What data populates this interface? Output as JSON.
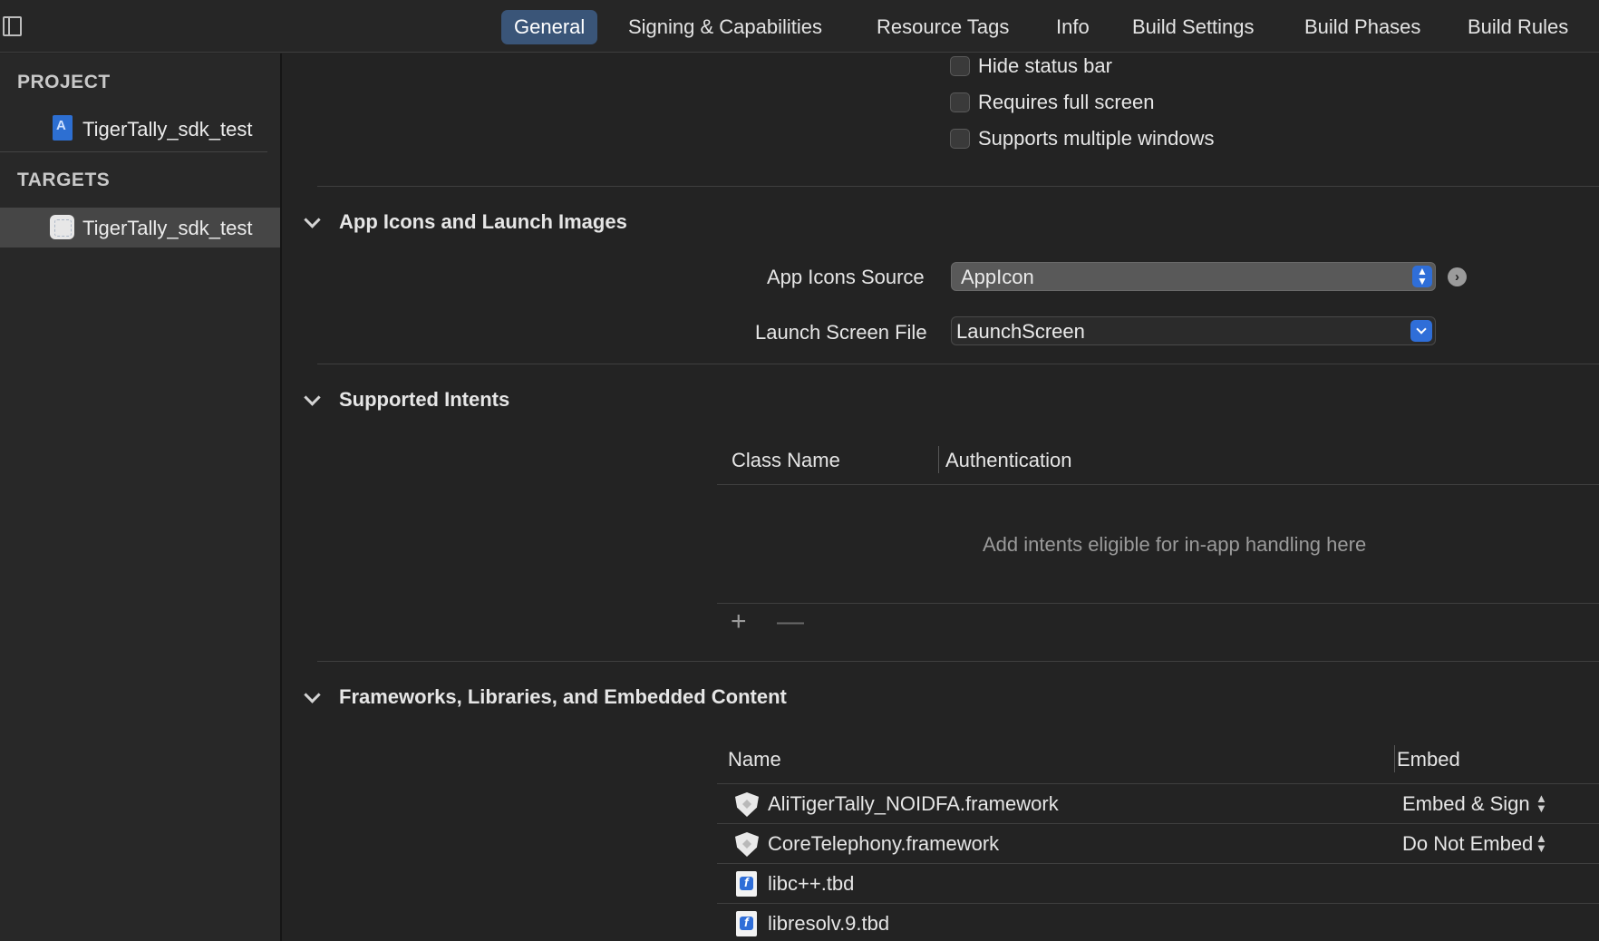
{
  "tabs": [
    {
      "label": "General",
      "active": true
    },
    {
      "label": "Signing & Capabilities"
    },
    {
      "label": "Resource Tags"
    },
    {
      "label": "Info"
    },
    {
      "label": "Build Settings"
    },
    {
      "label": "Build Phases"
    },
    {
      "label": "Build Rules"
    }
  ],
  "sidebar": {
    "project_header": "PROJECT",
    "project_item": "TigerTally_sdk_test",
    "targets_header": "TARGETS",
    "target_item": "TigerTally_sdk_test"
  },
  "deployment": {
    "checkboxes": [
      {
        "label": "Hide status bar",
        "checked": false
      },
      {
        "label": "Requires full screen",
        "checked": false
      },
      {
        "label": "Supports multiple windows",
        "checked": false
      }
    ]
  },
  "app_icons": {
    "title": "App Icons and Launch Images",
    "icons_source_label": "App Icons Source",
    "icons_source_value": "AppIcon",
    "launch_screen_label": "Launch Screen File",
    "launch_screen_value": "LaunchScreen"
  },
  "intents": {
    "title": "Supported Intents",
    "col_class_name": "Class Name",
    "col_authentication": "Authentication",
    "empty_message": "Add intents eligible for in-app handling here",
    "add_label": "+",
    "remove_label": "—"
  },
  "frameworks": {
    "title": "Frameworks, Libraries, and Embedded Content",
    "col_name": "Name",
    "col_embed": "Embed",
    "items": [
      {
        "name": "AliTigerTally_NOIDFA.framework",
        "embed": "Embed & Sign",
        "icon": "shield-icon"
      },
      {
        "name": "CoreTelephony.framework",
        "embed": "Do Not Embed",
        "icon": "shield-icon"
      },
      {
        "name": "libc++.tbd",
        "embed": "",
        "icon": "tbd-file-icon"
      },
      {
        "name": "libresolv.9.tbd",
        "embed": "",
        "icon": "tbd-file-icon"
      }
    ]
  },
  "icons": {
    "sidebar_toggle": "sidebar-toggle-icon",
    "goto": "arrow-right-circle-icon",
    "stepper": "up-down-chevron-icon",
    "dropdown": "chevron-down-icon"
  },
  "colors": {
    "accent": "#2f6ed8",
    "tab_active": "#3a5578",
    "background": "#232323"
  }
}
